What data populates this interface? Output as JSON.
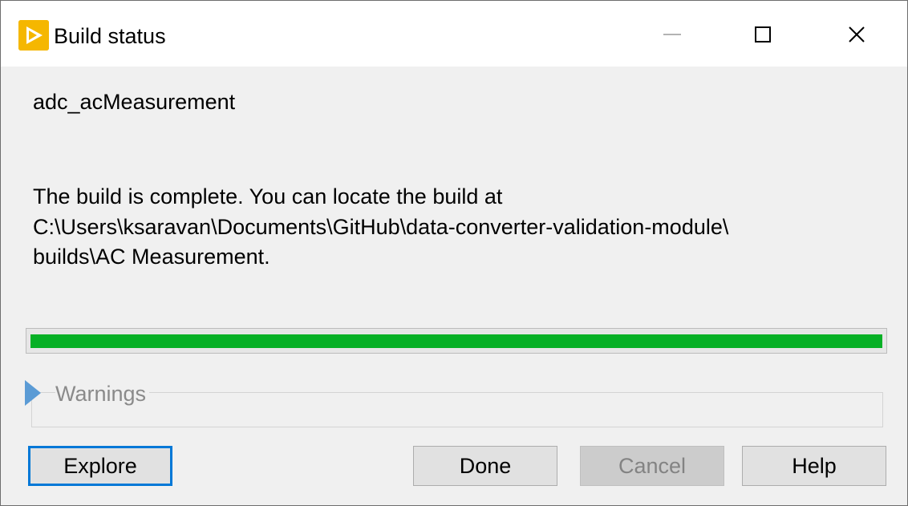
{
  "window": {
    "title": "Build status",
    "icon": "labview-run-arrow-icon",
    "controls": [
      "minimize-icon",
      "maximize-icon",
      "close-icon"
    ]
  },
  "project_name": "adc_acMeasurement",
  "message": {
    "line1": "The build is complete. You can locate the build at",
    "line2": "C:\\Users\\ksaravan\\Documents\\GitHub\\data-converter-validation-module\\",
    "line3": "builds\\AC Measurement."
  },
  "progress": {
    "percent": 100,
    "color": "#06b025"
  },
  "warnings": {
    "label": "Warnings",
    "expanded": false
  },
  "buttons": {
    "explore": "Explore",
    "done": "Done",
    "cancel": "Cancel",
    "help": "Help"
  },
  "colors": {
    "focus_border": "#0078d7",
    "icon_bg": "#f5b700"
  }
}
